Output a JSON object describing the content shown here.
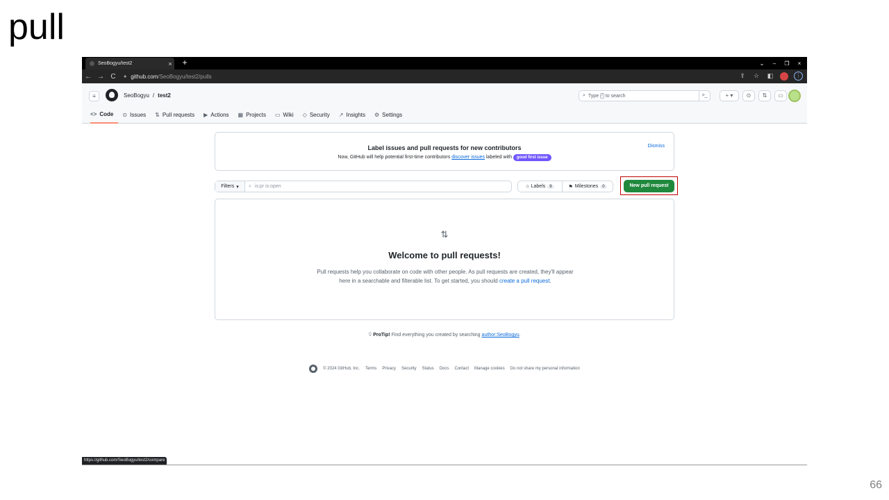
{
  "slide": {
    "title": "pull",
    "page_number": "66"
  },
  "browser": {
    "tab_title": "SeoBogyu/test2",
    "tab_close": "×",
    "new_tab": "+",
    "window_controls": [
      "⌄",
      "–",
      "❐",
      "×"
    ],
    "back": "←",
    "forward": "→",
    "reload": "C",
    "url_host": "github.com",
    "url_path": "/SeoBogyu/test2/pulls",
    "status_url": "https://github.com/SeoBogyu/test2/compare"
  },
  "header": {
    "owner": "SeoBogyu",
    "separator": "/",
    "repo": "test2",
    "search_prefix": "Type",
    "search_key": "/",
    "search_suffix": "to search",
    "cmd_palette": ">_",
    "new_menu": "+ ▾"
  },
  "repo_tabs": [
    {
      "label": "Code",
      "icon": "<>"
    },
    {
      "label": "Issues",
      "icon": "⊙"
    },
    {
      "label": "Pull requests",
      "icon": "⇅"
    },
    {
      "label": "Actions",
      "icon": "▶"
    },
    {
      "label": "Projects",
      "icon": "▦"
    },
    {
      "label": "Wiki",
      "icon": "▭"
    },
    {
      "label": "Security",
      "icon": "◇"
    },
    {
      "label": "Insights",
      "icon": "↗"
    },
    {
      "label": "Settings",
      "icon": "⚙"
    }
  ],
  "banner": {
    "title": "Label issues and pull requests for new contributors",
    "text_before": "Now, GitHub will help potential first-time contributors",
    "link": "discover issues",
    "text_after": "labeled with",
    "label": "good first issue",
    "dismiss": "Dismiss"
  },
  "toolbar": {
    "filters_label": "Filters",
    "search_placeholder": "is:pr is:open",
    "labels_label": "Labels",
    "labels_count": "9",
    "milestones_label": "Milestones",
    "milestones_count": "0",
    "new_pr_label": "New pull request"
  },
  "blankslate": {
    "title": "Welcome to pull requests!",
    "text_before": "Pull requests help you collaborate on code with other people. As pull requests are created, they'll appear here in a searchable and filterable list. To get started, you should",
    "link": "create a pull request",
    "text_after": "."
  },
  "protip": {
    "bold": "ProTip!",
    "text": "Find everything you created by searching",
    "link": "author:SeoBogyu",
    "end": "."
  },
  "footer": {
    "copyright": "© 2024 GitHub, Inc.",
    "links": [
      "Terms",
      "Privacy",
      "Security",
      "Status",
      "Docs",
      "Contact",
      "Manage cookies",
      "Do not share my personal information"
    ]
  },
  "colors": {
    "accent": "#1f883d",
    "link": "#0969da",
    "highlight": "#c00000",
    "label": "#7057ff"
  }
}
